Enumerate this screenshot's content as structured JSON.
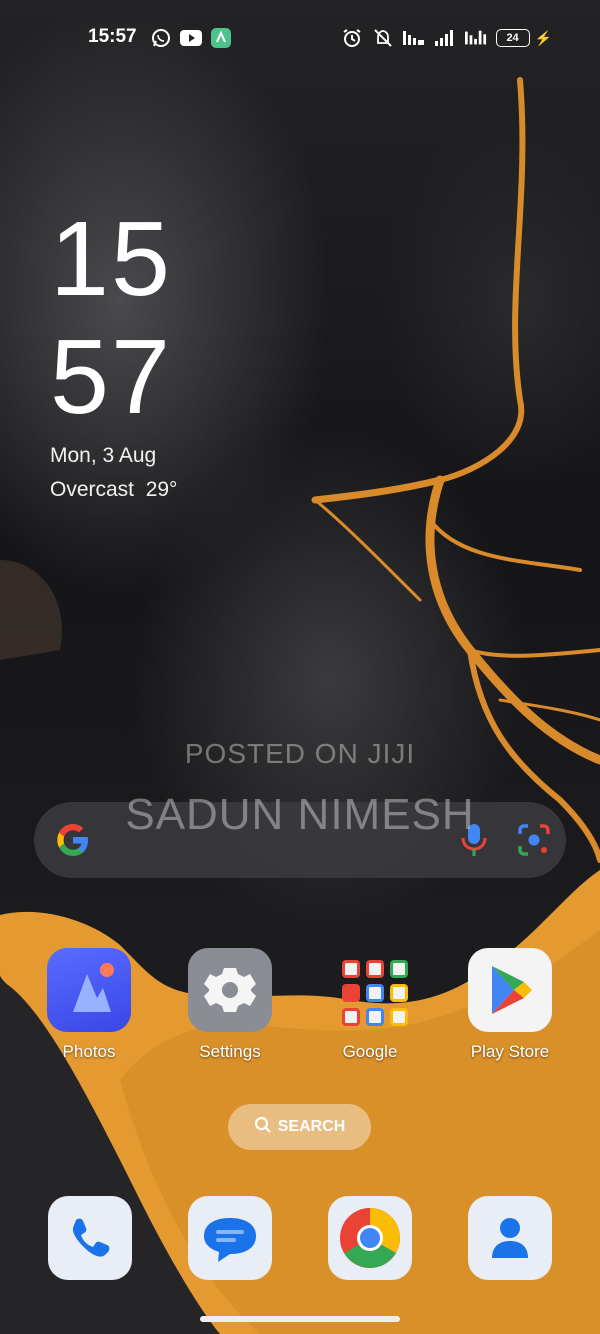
{
  "status_bar": {
    "time": "15:57",
    "battery_level": "24",
    "app_icons": [
      "whatsapp-icon",
      "youtube-icon",
      "app-notification-icon"
    ],
    "system_icons": [
      "alarm-icon",
      "do-not-disturb-icon",
      "volte-signal-icon",
      "signal-bars-icon",
      "wifi-signal-icon"
    ]
  },
  "clock_widget": {
    "hour": "15",
    "minute": "57",
    "date": "Mon, 3 Aug",
    "weather": "Overcast",
    "temperature": "29°"
  },
  "watermark": {
    "line1": "POSTED ON JIJI",
    "line2": "SADUN NIMESH"
  },
  "search_bar": {
    "icons": [
      "google-g-icon",
      "microphone-icon",
      "google-lens-icon"
    ]
  },
  "apps": [
    {
      "label": "Photos",
      "icon": "photos-icon"
    },
    {
      "label": "Settings",
      "icon": "gear-icon"
    },
    {
      "label": "Google",
      "icon": "google-folder-icon"
    },
    {
      "label": "Play Store",
      "icon": "play-store-icon"
    }
  ],
  "app_search_pill": {
    "label": "SEARCH"
  },
  "dock": [
    "phone-icon",
    "messages-icon",
    "chrome-icon",
    "contacts-icon"
  ],
  "colors": {
    "accent_orange": "#e79a2a",
    "photos_blue": "#4a57f2",
    "google_blue": "#4285f4",
    "google_red": "#ea4335",
    "google_yellow": "#fbbc05",
    "google_green": "#34a853"
  }
}
